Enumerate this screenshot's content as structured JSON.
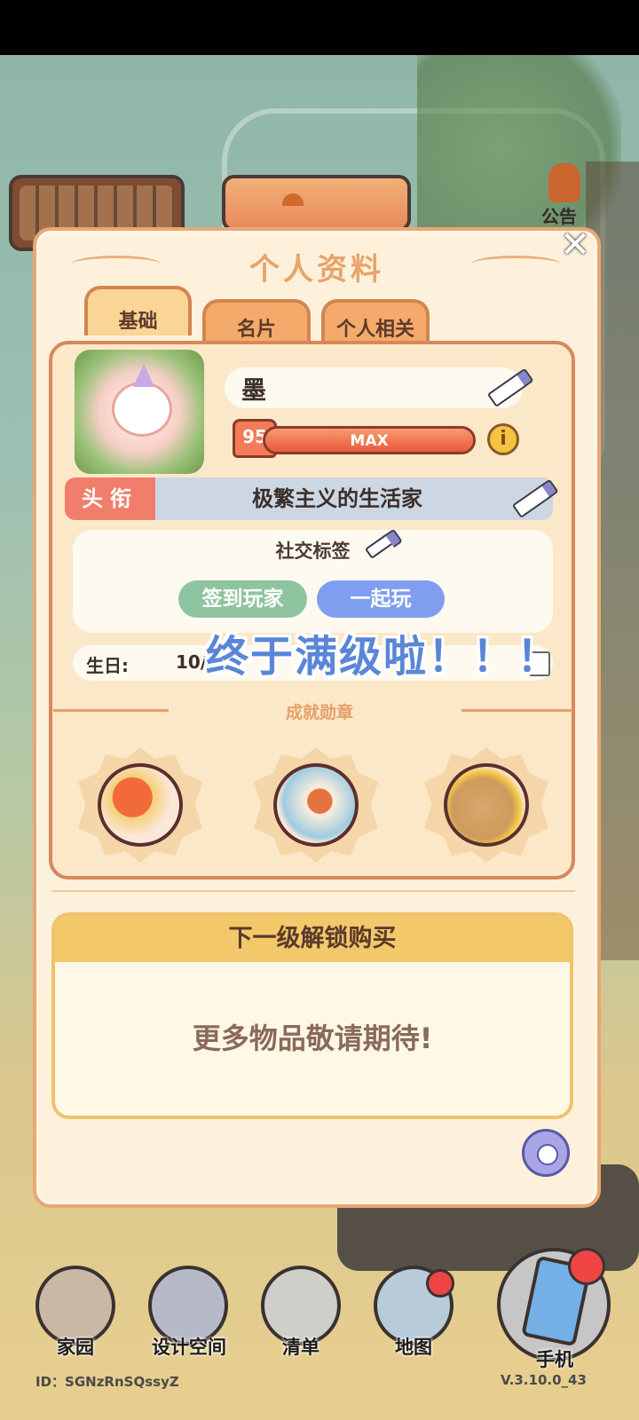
{
  "top": {
    "notice_label": "公告"
  },
  "dialog": {
    "title": "个人资料",
    "close_symbol": "✕",
    "tabs": [
      {
        "label": "基础",
        "active": true
      },
      {
        "label": "名片",
        "active": false
      },
      {
        "label": "个人相关",
        "active": false
      }
    ]
  },
  "profile": {
    "name": "墨",
    "level": "95",
    "level_text": "MAX",
    "level_progress": 1.0,
    "info_symbol": "i",
    "title_label": "头衔",
    "title_value": "极繁主义的生活家",
    "social_tags_title": "社交标签",
    "social_tags": [
      {
        "label": "签到玩家",
        "color": "#8fc4a0"
      },
      {
        "label": "一起玩",
        "color": "#7f9ef0"
      }
    ],
    "birthday_label": "生日:",
    "birthday_value": "10/2"
  },
  "overlay_caption": "终于满级啦！！！",
  "achievements": {
    "title": "成就勋章",
    "badges": [
      {
        "icon": "sun-moon-cloud-icon"
      },
      {
        "icon": "koi-fish-icon"
      },
      {
        "icon": "money-bag-coins-icon"
      }
    ]
  },
  "unlock": {
    "header": "下一级解锁购买",
    "body": "更多物品敬请期待!"
  },
  "bottom_nav": [
    {
      "label": "家园",
      "icon": "home-icon"
    },
    {
      "label": "设计空间",
      "icon": "design-icon"
    },
    {
      "label": "清单",
      "icon": "checklist-icon"
    },
    {
      "label": "地图",
      "icon": "map-pin-icon"
    },
    {
      "label": "手机",
      "icon": "phone-icon"
    }
  ],
  "footer": {
    "id_text": "ID：SGNzRnSQssyZ",
    "version_text": "V.3.10.0_43"
  },
  "colors": {
    "accent": "#e9a774",
    "panel_bg": "#fdf1dc",
    "level_bar": "#f07050"
  }
}
